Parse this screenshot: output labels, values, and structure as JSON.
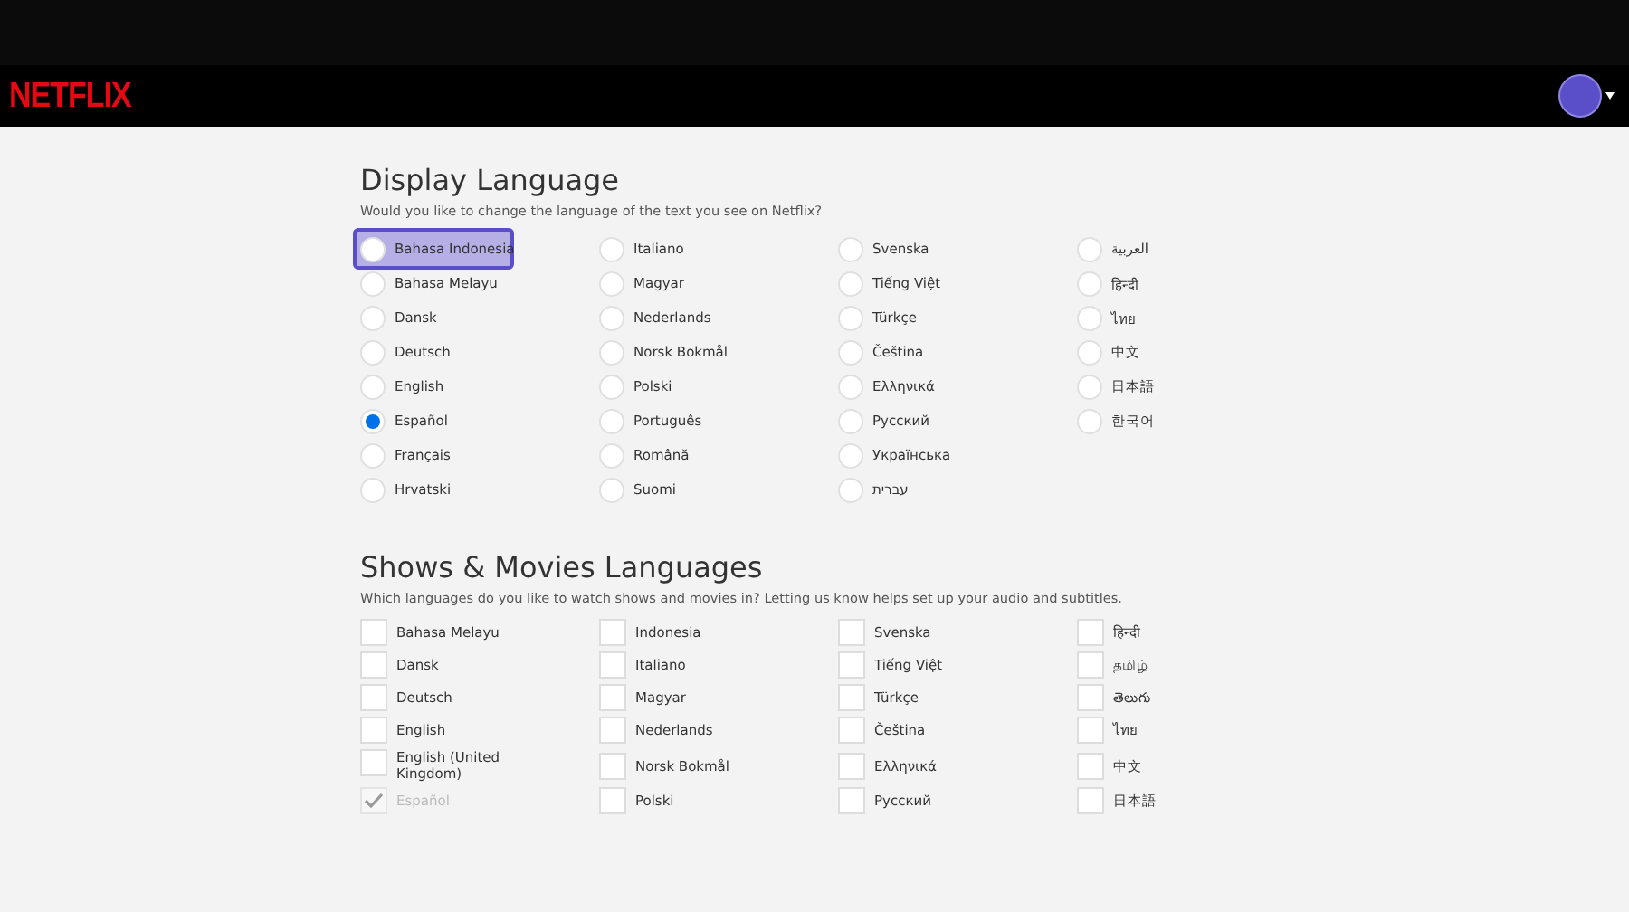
{
  "header": {
    "logo": "NETFLIX"
  },
  "display_language": {
    "title": "Display Language",
    "description": "Would you like to change the language of the text you see on Netflix?",
    "options": [
      {
        "label": "Bahasa Indonesia",
        "selected": false,
        "focused": true
      },
      {
        "label": "Bahasa Melayu",
        "selected": false,
        "focused": false
      },
      {
        "label": "Dansk",
        "selected": false,
        "focused": false
      },
      {
        "label": "Deutsch",
        "selected": false,
        "focused": false
      },
      {
        "label": "English",
        "selected": false,
        "focused": false
      },
      {
        "label": "Español",
        "selected": true,
        "focused": false
      },
      {
        "label": "Français",
        "selected": false,
        "focused": false
      },
      {
        "label": "Hrvatski",
        "selected": false,
        "focused": false
      },
      {
        "label": "Italiano",
        "selected": false,
        "focused": false
      },
      {
        "label": "Magyar",
        "selected": false,
        "focused": false
      },
      {
        "label": "Nederlands",
        "selected": false,
        "focused": false
      },
      {
        "label": "Norsk Bokmål",
        "selected": false,
        "focused": false
      },
      {
        "label": "Polski",
        "selected": false,
        "focused": false
      },
      {
        "label": "Português",
        "selected": false,
        "focused": false
      },
      {
        "label": "Română",
        "selected": false,
        "focused": false
      },
      {
        "label": "Suomi",
        "selected": false,
        "focused": false
      },
      {
        "label": "Svenska",
        "selected": false,
        "focused": false
      },
      {
        "label": "Tiếng Việt",
        "selected": false,
        "focused": false
      },
      {
        "label": "Türkçe",
        "selected": false,
        "focused": false
      },
      {
        "label": "Čeština",
        "selected": false,
        "focused": false
      },
      {
        "label": "Ελληνικά",
        "selected": false,
        "focused": false
      },
      {
        "label": "Русский",
        "selected": false,
        "focused": false
      },
      {
        "label": "Українська",
        "selected": false,
        "focused": false
      },
      {
        "label": "עברית",
        "selected": false,
        "focused": false
      },
      {
        "label": "العربية",
        "selected": false,
        "focused": false
      },
      {
        "label": "हिन्दी",
        "selected": false,
        "focused": false
      },
      {
        "label": "ไทย",
        "selected": false,
        "focused": false
      },
      {
        "label": "中文",
        "selected": false,
        "focused": false
      },
      {
        "label": "日本語",
        "selected": false,
        "focused": false
      },
      {
        "label": "한국어",
        "selected": false,
        "focused": false
      }
    ]
  },
  "shows_movies_languages": {
    "title": "Shows & Movies Languages",
    "description": "Which languages do you like to watch shows and movies in? Letting us know helps set up your audio and subtitles.",
    "options": [
      {
        "label": "Bahasa Melayu",
        "checked": false,
        "disabled": false
      },
      {
        "label": "Dansk",
        "checked": false,
        "disabled": false
      },
      {
        "label": "Deutsch",
        "checked": false,
        "disabled": false
      },
      {
        "label": "English",
        "checked": false,
        "disabled": false
      },
      {
        "label": "English (United Kingdom)",
        "checked": false,
        "disabled": false
      },
      {
        "label": "Español",
        "checked": true,
        "disabled": true
      },
      {
        "label": "Indonesia",
        "checked": false,
        "disabled": false
      },
      {
        "label": "Italiano",
        "checked": false,
        "disabled": false
      },
      {
        "label": "Magyar",
        "checked": false,
        "disabled": false
      },
      {
        "label": "Nederlands",
        "checked": false,
        "disabled": false
      },
      {
        "label": "Norsk Bokmål",
        "checked": false,
        "disabled": false
      },
      {
        "label": "Polski",
        "checked": false,
        "disabled": false
      },
      {
        "label": "Svenska",
        "checked": false,
        "disabled": false
      },
      {
        "label": "Tiếng Việt",
        "checked": false,
        "disabled": false
      },
      {
        "label": "Türkçe",
        "checked": false,
        "disabled": false
      },
      {
        "label": "Čeština",
        "checked": false,
        "disabled": false
      },
      {
        "label": "Ελληνικά",
        "checked": false,
        "disabled": false
      },
      {
        "label": "Русский",
        "checked": false,
        "disabled": false
      },
      {
        "label": "हिन्दी",
        "checked": false,
        "disabled": false
      },
      {
        "label": "தமிழ்",
        "checked": false,
        "disabled": false
      },
      {
        "label": "తెలుగు",
        "checked": false,
        "disabled": false
      },
      {
        "label": "ไทย",
        "checked": false,
        "disabled": false
      },
      {
        "label": "中文",
        "checked": false,
        "disabled": false
      },
      {
        "label": "日本語",
        "checked": false,
        "disabled": false
      }
    ]
  }
}
